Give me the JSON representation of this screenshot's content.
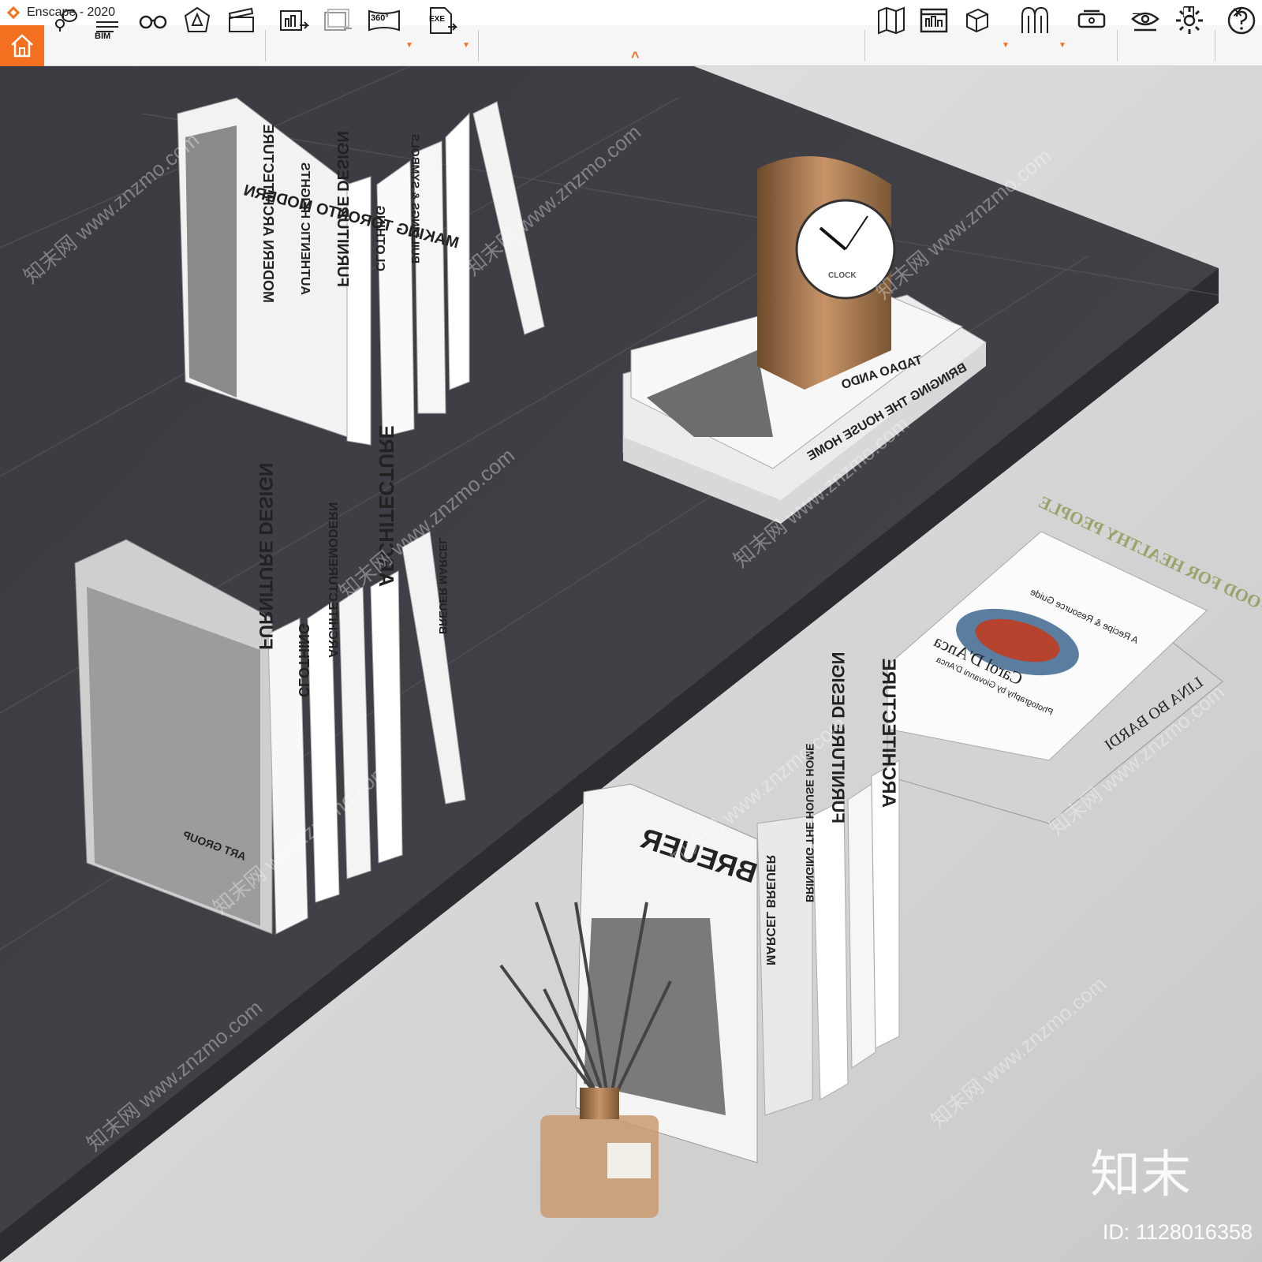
{
  "window": {
    "title": "Enscape - 2020"
  },
  "window_controls": {
    "minimize": "—",
    "restore": "❐",
    "close": "✕"
  },
  "toolbar": {
    "bim_label": "BIM",
    "pano_label": "360°",
    "exe_label": "EXE",
    "collapse_caret": "^"
  },
  "scene": {
    "books_group_1": [
      "MAKING TORONTO MODERN",
      "MODERN ARCHITECTURE",
      "AUTHENTIC HEIGHTS",
      "FURNITURE DESIGN",
      "CLOTHING",
      "BUILDINGS & SYMBOLS"
    ],
    "books_group_2": [
      "TADAO ANDO",
      "BRINGING THE HOUSE HOME",
      "CLOCK"
    ],
    "books_group_3": [
      "FURNITURE DESIGN",
      "ART GROUP",
      "CLOTHING",
      "ARCHITECTUREMODERN",
      "ARCHITECTURE",
      "BREUER MARCEL"
    ],
    "books_group_4": [
      "REAL FOOD FOR HEALTHY PEOPLE",
      "A Recipe & Resource Guide",
      "Carol D'Anca",
      "Photography by Giovanni D'Anca",
      "LINA BO BARDI"
    ],
    "books_group_5": [
      "BREUER",
      "MARCEL BREUER",
      "BRINGING THE HOUSE HOME",
      "FURNITURE DESIGN",
      "ARCHITECTURE"
    ],
    "watermark": "知末网 www.znzmo.com",
    "brand_mark": "知末",
    "image_id": "ID: 1128016358"
  },
  "colors": {
    "accent": "#f37021",
    "floor_dark": "#3d3d42",
    "surface_light": "#d6d6d6"
  },
  "icons": [
    "home-icon",
    "location-icon",
    "bim-icon",
    "binoculars-icon",
    "assets-icon",
    "clapper-icon",
    "render-image-icon",
    "batch-render-icon",
    "panorama-icon",
    "export-exe-icon",
    "map-icon",
    "view-management-icon",
    "cube-icon",
    "material-icon",
    "vr-headset-icon",
    "visual-settings-icon",
    "settings-icon",
    "help-icon"
  ]
}
